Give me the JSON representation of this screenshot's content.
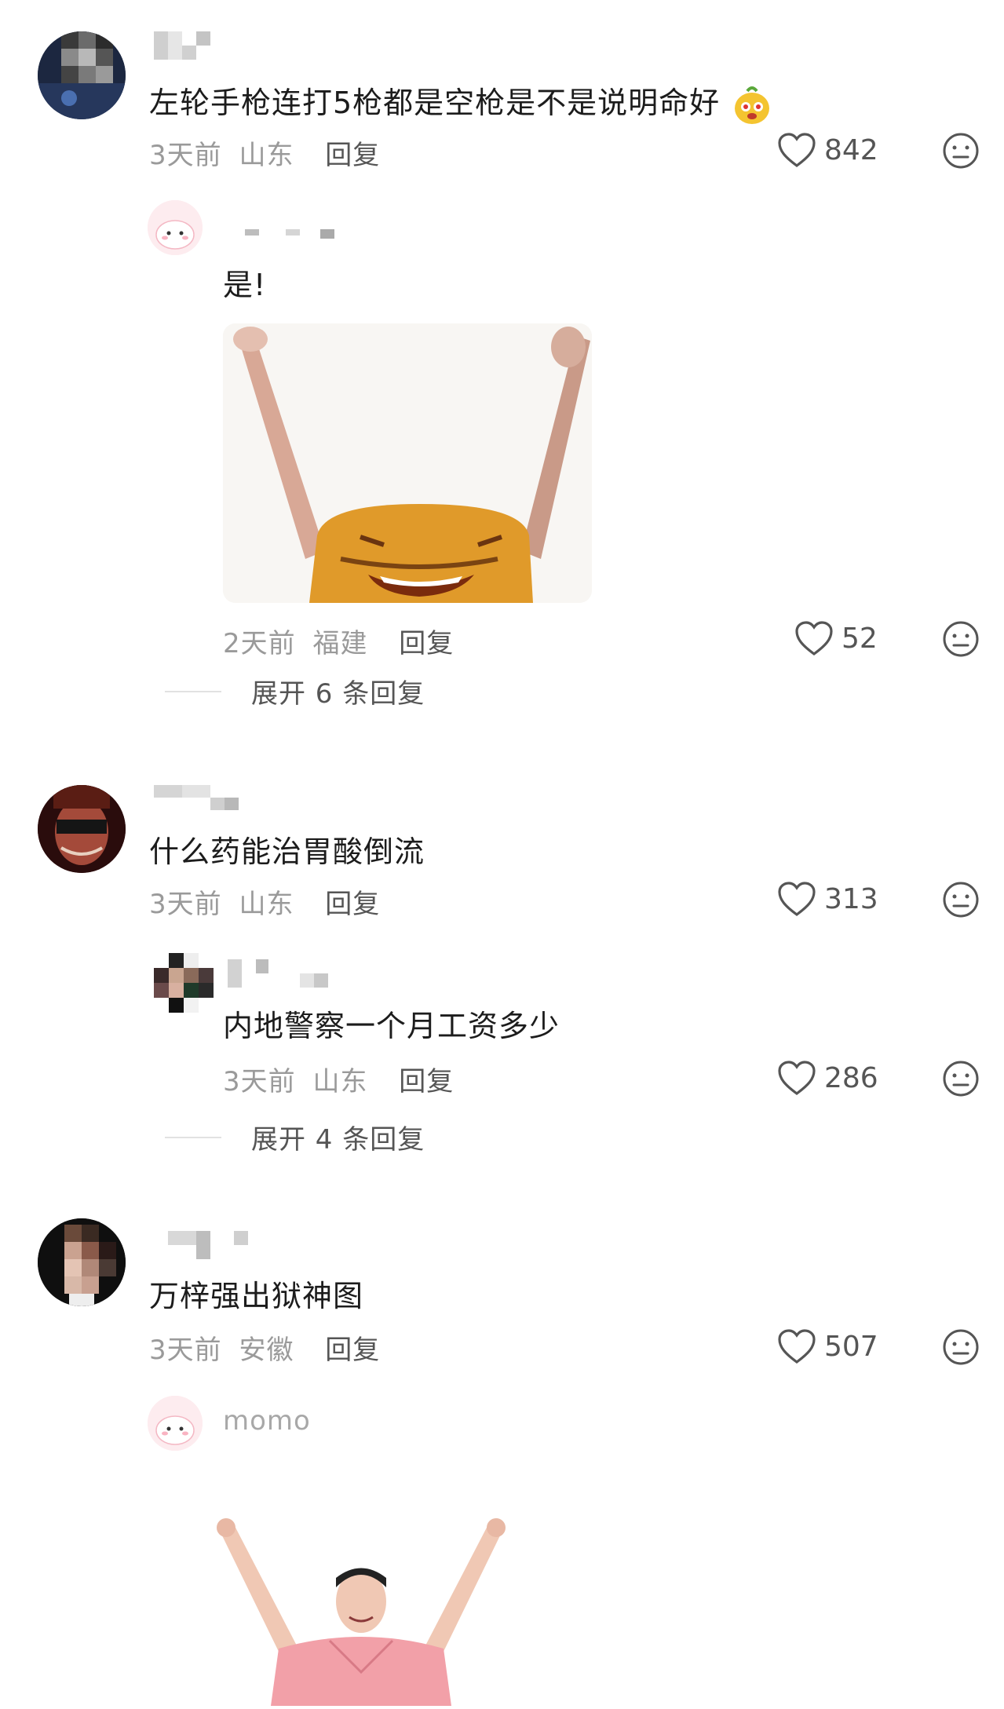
{
  "comments": [
    {
      "text": "左轮手枪连打5枪都是空枪是不是说明命好",
      "time": "3天前",
      "location": "山东",
      "reply_label": "回复",
      "likes": "842",
      "replies": [
        {
          "text": "是!",
          "time": "2天前",
          "location": "福建",
          "reply_label": "回复",
          "likes": "52"
        }
      ],
      "expand_label": "展开 6 条回复"
    },
    {
      "text": "什么药能治胃酸倒流",
      "time": "3天前",
      "location": "山东",
      "reply_label": "回复",
      "likes": "313",
      "replies": [
        {
          "text": "内地警察一个月工资多少",
          "time": "3天前",
          "location": "山东",
          "reply_label": "回复",
          "likes": "286"
        }
      ],
      "expand_label": "展开 4 条回复"
    },
    {
      "text": "万梓强出狱神图",
      "time": "3天前",
      "location": "安徽",
      "reply_label": "回复",
      "likes": "507",
      "replies": [
        {
          "username": "momo"
        }
      ]
    }
  ],
  "colors": {
    "like_icon": "#555555",
    "meta_text": "#9a9a9a",
    "pink_avatar": "#fde6ea"
  },
  "icons": [
    "heart-icon",
    "neutral-face-icon",
    "emoji-sticker-icon"
  ]
}
